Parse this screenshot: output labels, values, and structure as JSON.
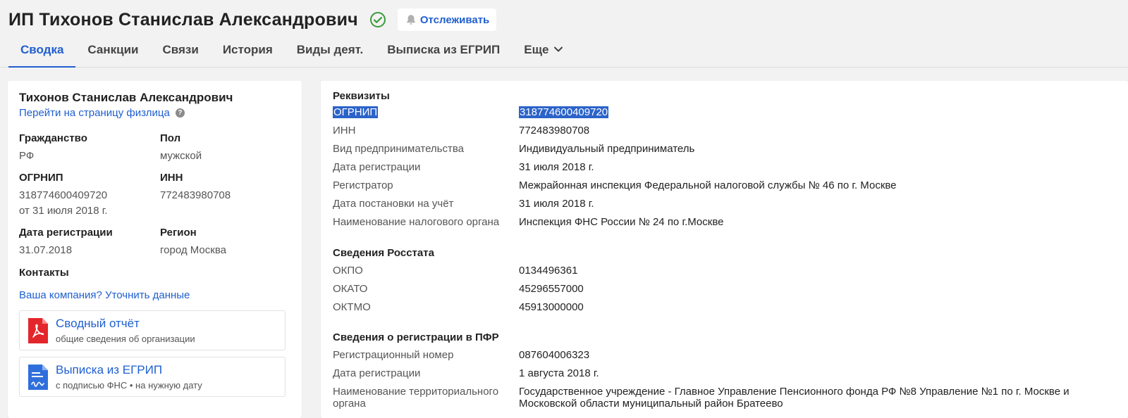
{
  "header": {
    "title": "ИП Тихонов Станислав Александрович",
    "track_label": "Отслеживать",
    "icons": {
      "verified": "check-circle-icon",
      "bell": "bell-icon"
    }
  },
  "tabs": [
    {
      "label": "Сводка",
      "active": true
    },
    {
      "label": "Санкции"
    },
    {
      "label": "Связи"
    },
    {
      "label": "История"
    },
    {
      "label": "Виды деят."
    },
    {
      "label": "Выписка из ЕГРИП"
    },
    {
      "label": "Еще"
    }
  ],
  "left": {
    "name": "Тихонов Станислав Александрович",
    "person_link": "Перейти на страницу физлица",
    "citizenship_label": "Гражданство",
    "citizenship_value": "РФ",
    "sex_label": "Пол",
    "sex_value": "мужской",
    "ogrnip_label": "ОГРНИП",
    "ogrnip_value": "318774600409720",
    "ogrnip_date": "от 31 июля 2018 г.",
    "inn_label": "ИНН",
    "inn_value": "772483980708",
    "reg_date_label": "Дата регистрации",
    "reg_date_value": "31.07.2018",
    "region_label": "Регион",
    "region_value": "город Москва",
    "contacts_label": "Контакты",
    "contacts_link": "Ваша компания? Уточнить данные",
    "docs": [
      {
        "title": "Сводный отчёт",
        "subtitle": "общие сведения об организации",
        "icon": "pdf-icon"
      },
      {
        "title": "Выписка из ЕГРИП",
        "subtitle": "с подписью ФНС • на нужную дату",
        "icon": "signed-document-icon"
      }
    ]
  },
  "right": {
    "requisites_title": "Реквизиты",
    "requisites": [
      {
        "label": "ОГРНИП",
        "value": "318774600409720"
      },
      {
        "label": "ИНН",
        "value": "772483980708"
      },
      {
        "label": "Вид предпринимательства",
        "value": "Индивидуальный предприниматель"
      },
      {
        "label": "Дата регистрации",
        "value": "31 июля 2018 г."
      },
      {
        "label": "Регистратор",
        "value": "Межрайонная инспекция Федеральной налоговой службы № 46 по г. Москве"
      },
      {
        "label": "Дата постановки на учёт",
        "value": "31 июля 2018 г."
      },
      {
        "label": "Наименование налогового органа",
        "value": "Инспекция ФНС России № 24 по г.Москве"
      }
    ],
    "rosstat_title": "Сведения Росстата",
    "rosstat": [
      {
        "label": "ОКПО",
        "value": "0134496361"
      },
      {
        "label": "ОКАТО",
        "value": "45296557000"
      },
      {
        "label": "ОКТМО",
        "value": "45913000000"
      }
    ],
    "pfr_title": "Сведения о регистрации в ПФР",
    "pfr": [
      {
        "label": "Регистрационный номер",
        "value": "087604006323"
      },
      {
        "label": "Дата регистрации",
        "value": "1 августа 2018 г."
      },
      {
        "label": "Наименование территориального органа",
        "value": "Государственное учреждение - Главное Управление Пенсионного фонда РФ №8 Управление №1 по г. Москве и Московской области муниципальный район Братеево"
      }
    ]
  },
  "colors": {
    "accent": "#1f5fcf",
    "verified": "#3a9a3a",
    "pdf": "#e3262b",
    "doc": "#2f6fdc",
    "selection": "#2b63c9"
  }
}
